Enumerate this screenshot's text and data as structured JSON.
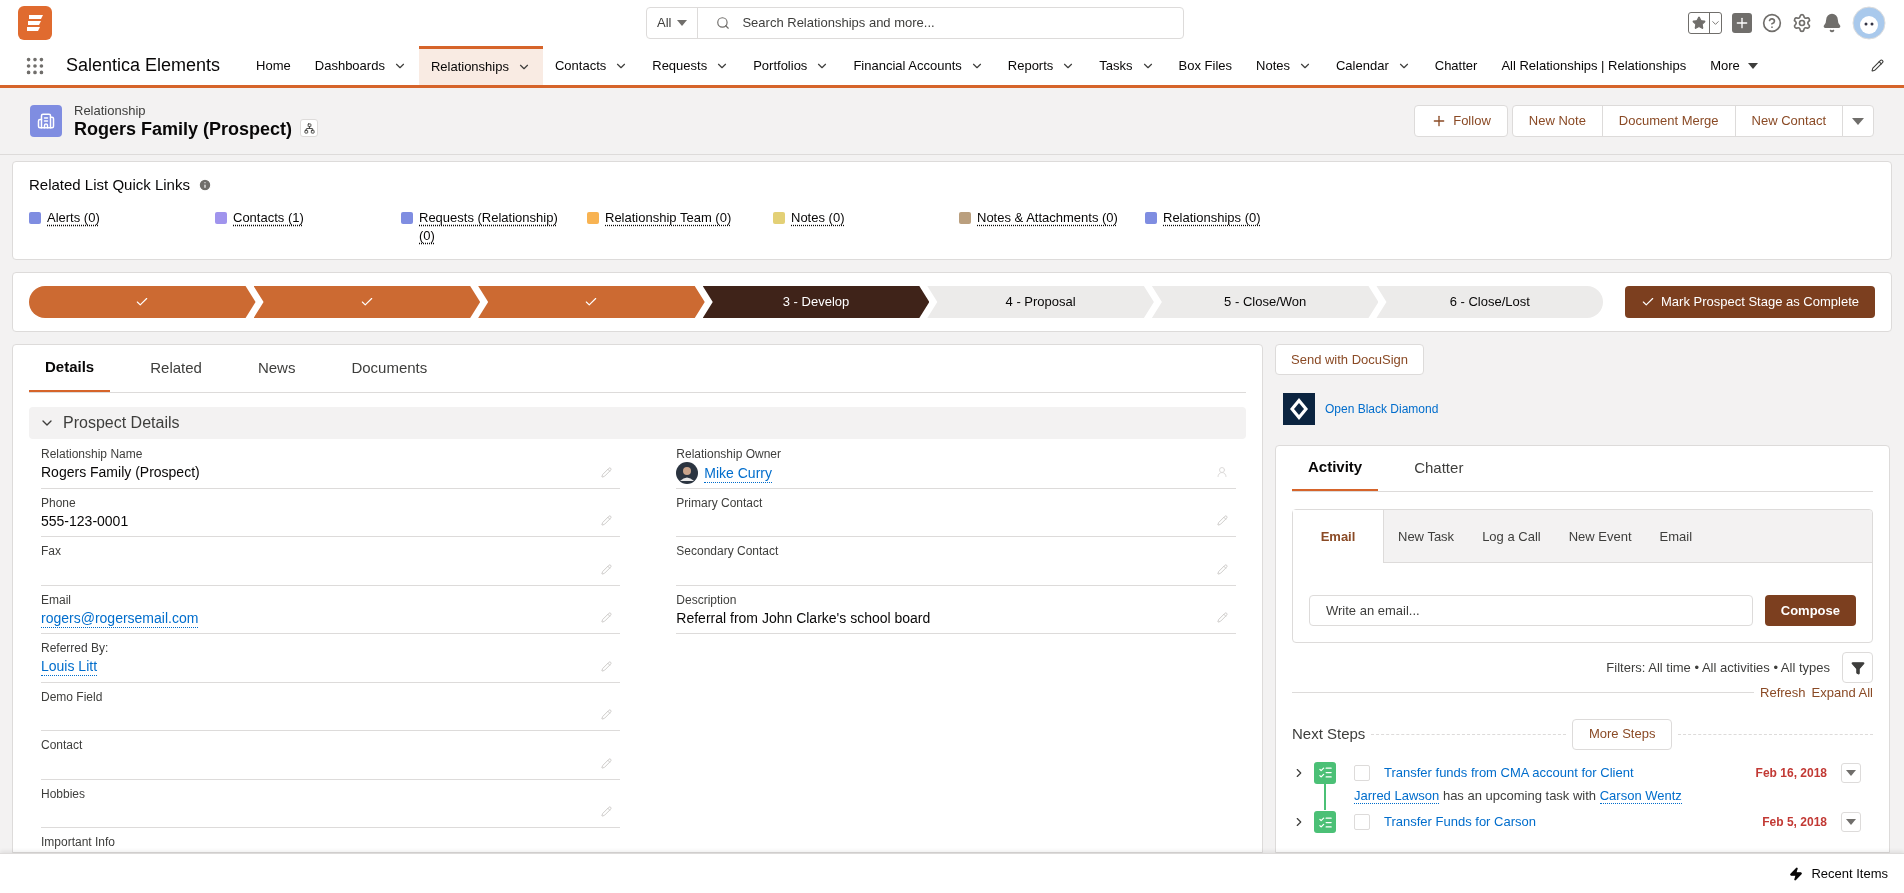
{
  "header": {
    "search_scope": "All",
    "search_placeholder": "Search Relationships and more..."
  },
  "nav": {
    "app_name": "Salentica Elements",
    "items": [
      {
        "label": "Home",
        "dropdown": false,
        "selected": false
      },
      {
        "label": "Dashboards",
        "dropdown": true,
        "selected": false
      },
      {
        "label": "Relationships",
        "dropdown": true,
        "selected": true
      },
      {
        "label": "Contacts",
        "dropdown": true,
        "selected": false
      },
      {
        "label": "Requests",
        "dropdown": true,
        "selected": false
      },
      {
        "label": "Portfolios",
        "dropdown": true,
        "selected": false
      },
      {
        "label": "Financial Accounts",
        "dropdown": true,
        "selected": false
      },
      {
        "label": "Reports",
        "dropdown": true,
        "selected": false
      },
      {
        "label": "Tasks",
        "dropdown": true,
        "selected": false
      },
      {
        "label": "Box Files",
        "dropdown": false,
        "selected": false
      },
      {
        "label": "Notes",
        "dropdown": true,
        "selected": false
      },
      {
        "label": "Calendar",
        "dropdown": true,
        "selected": false
      },
      {
        "label": "Chatter",
        "dropdown": false,
        "selected": false
      },
      {
        "label": "All Relationships | Relationships",
        "dropdown": false,
        "selected": false
      }
    ],
    "more": "More"
  },
  "record": {
    "object": "Relationship",
    "title": "Rogers Family (Prospect)",
    "actions": [
      "Follow",
      "New Note",
      "Document Merge",
      "New Contact"
    ]
  },
  "quick_links": {
    "title": "Related List Quick Links",
    "items": [
      {
        "label": "Alerts (0)",
        "color": "#7f8de1"
      },
      {
        "label": "Contacts (1)",
        "color": "#a094ed"
      },
      {
        "label": "Requests (Relationship) (0)",
        "color": "#7f8de1"
      },
      {
        "label": "Relationship Team (0)",
        "color": "#f8b352"
      },
      {
        "label": "Notes (0)",
        "color": "#e3d076"
      },
      {
        "label": "Notes & Attachments (0)",
        "color": "#ba9f7e"
      },
      {
        "label": "Relationships (0)",
        "color": "#7f8de1"
      }
    ]
  },
  "path": {
    "stages": [
      {
        "kind": "complete"
      },
      {
        "kind": "complete"
      },
      {
        "kind": "complete"
      },
      {
        "kind": "current",
        "label": "3 - Develop"
      },
      {
        "kind": "incomplete",
        "label": "4 - Proposal"
      },
      {
        "kind": "incomplete",
        "label": "5 - Close/Won"
      },
      {
        "kind": "incomplete",
        "label": "6 - Close/Lost"
      }
    ],
    "action": "Mark Prospect Stage as Complete"
  },
  "details": {
    "tabs": [
      {
        "label": "Details",
        "selected": true
      },
      {
        "label": "Related",
        "selected": false
      },
      {
        "label": "News",
        "selected": false
      },
      {
        "label": "Documents",
        "selected": false
      }
    ],
    "section": "Prospect Details",
    "left_fields": [
      {
        "label": "Relationship Name",
        "value": "Rogers Family (Prospect)",
        "kind": "text"
      },
      {
        "label": "Phone",
        "value": "555-123-0001",
        "kind": "text"
      },
      {
        "label": "Fax",
        "kind": "text"
      },
      {
        "label": "Email",
        "value": "rogers@rogersemail.com",
        "kind": "link"
      },
      {
        "label": "Referred By:",
        "value": "Louis Litt",
        "kind": "link"
      },
      {
        "label": "Demo Field",
        "kind": "text"
      },
      {
        "label": "Contact",
        "kind": "text"
      },
      {
        "label": "Hobbies",
        "kind": "text"
      },
      {
        "label": "Important Info",
        "kind": "text",
        "editable": false
      }
    ],
    "right_fields": [
      {
        "label": "Relationship Owner",
        "value": "Mike Curry",
        "kind": "owner"
      },
      {
        "label": "Primary Contact",
        "kind": "text"
      },
      {
        "label": "Secondary Contact",
        "kind": "text"
      },
      {
        "label": "Description",
        "value": "Referral from John Clarke's school board",
        "kind": "text"
      }
    ]
  },
  "side": {
    "docusign": "Send with DocuSign",
    "black_diamond": "Open Black Diamond",
    "activity": {
      "tabs": [
        {
          "label": "Activity",
          "selected": true
        },
        {
          "label": "Chatter",
          "selected": false
        }
      ],
      "composer_tabs": [
        {
          "label": "Email",
          "selected": true
        },
        {
          "label": "New Task",
          "selected": false
        },
        {
          "label": "Log a Call",
          "selected": false
        },
        {
          "label": "New Event",
          "selected": false
        },
        {
          "label": "Email",
          "selected": false
        }
      ],
      "email_placeholder": "Write an email...",
      "compose": "Compose",
      "filters": "Filters: All time • All activities • All types",
      "refresh": "Refresh",
      "expand_all": "Expand All",
      "next_steps": "Next Steps",
      "more_steps": "More Steps",
      "tasks": [
        {
          "title": "Transfer funds from CMA account for Client",
          "date": "Feb 16, 2018",
          "checked": false,
          "detail": {
            "owner": "Jarred Lawson",
            "text": "has an upcoming task with",
            "contact": "Carson Wentz"
          }
        },
        {
          "title": "Transfer Funds for Carson",
          "date": "Feb 5, 2018",
          "checked": false
        }
      ]
    }
  },
  "utility_bar": {
    "recent": "Recent Items"
  }
}
